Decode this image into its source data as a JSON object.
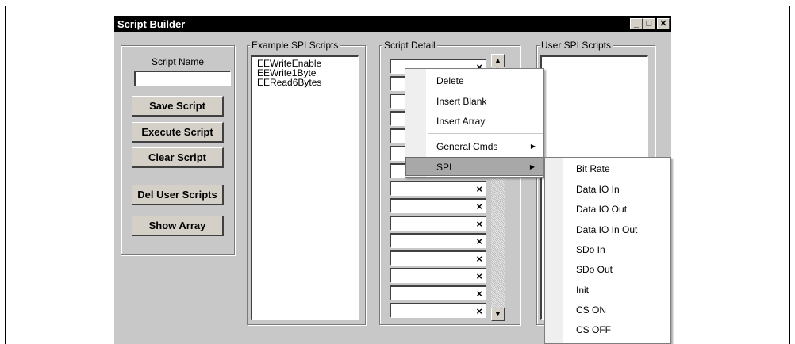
{
  "window": {
    "title": "Script Builder"
  },
  "window_controls": {
    "minimize": "_",
    "maximize": "□",
    "close": "✕"
  },
  "left_panel": {
    "script_name_label": "Script Name",
    "script_name_value": "",
    "buttons": {
      "save": "Save Script",
      "execute": "Execute Script",
      "clear": "Clear Script",
      "del_user": "Del User Scripts",
      "show_array": "Show Array"
    }
  },
  "example_scripts": {
    "legend": "Example SPI Scripts",
    "items": [
      "EEWriteEnable",
      "EEWrite1Byte",
      "EERead6Bytes"
    ]
  },
  "script_detail": {
    "legend": "Script Detail",
    "row_clear_glyph": "×"
  },
  "user_scripts": {
    "legend": "User SPI Scripts"
  },
  "context_menu": {
    "items": [
      "Delete",
      "Insert Blank",
      "Insert Array"
    ],
    "submenu_items": [
      "General Cmds",
      "SPI"
    ],
    "arrow": "▶"
  },
  "spi_submenu": {
    "items": [
      "Bit Rate",
      "Data IO In",
      "Data IO Out",
      "Data IO In Out",
      "SDo In",
      "SDo Out",
      "Init",
      "CS ON",
      "CS OFF"
    ]
  },
  "icons": {
    "scroll_up": "▲",
    "scroll_down": "▼"
  }
}
